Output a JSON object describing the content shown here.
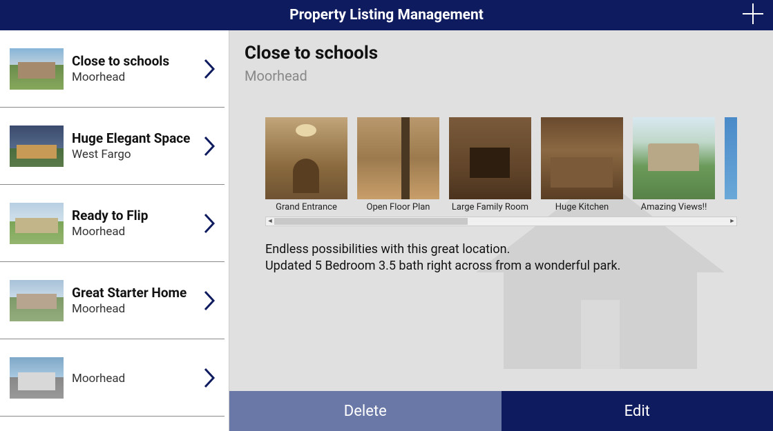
{
  "header": {
    "title": "Property Listing Management"
  },
  "listings": [
    {
      "title": "Close to schools",
      "location": "Moorhead"
    },
    {
      "title": "Huge Elegant Space",
      "location": "West Fargo"
    },
    {
      "title": "Ready to Flip",
      "location": "Moorhead"
    },
    {
      "title": "Great Starter Home",
      "location": "Moorhead"
    },
    {
      "title": "",
      "location": "Moorhead"
    }
  ],
  "detail": {
    "title": "Close to schools",
    "location": "Moorhead",
    "gallery": [
      {
        "caption": "Grand Entrance"
      },
      {
        "caption": "Open Floor Plan"
      },
      {
        "caption": "Large Family Room"
      },
      {
        "caption": "Huge Kitchen"
      },
      {
        "caption": "Amazing Views!!"
      },
      {
        "caption": ""
      }
    ],
    "description": "Endless possibilities with this great location.\nUpdated 5 Bedroom 3.5 bath right across from a wonderful park."
  },
  "actions": {
    "delete_label": "Delete",
    "edit_label": "Edit"
  }
}
